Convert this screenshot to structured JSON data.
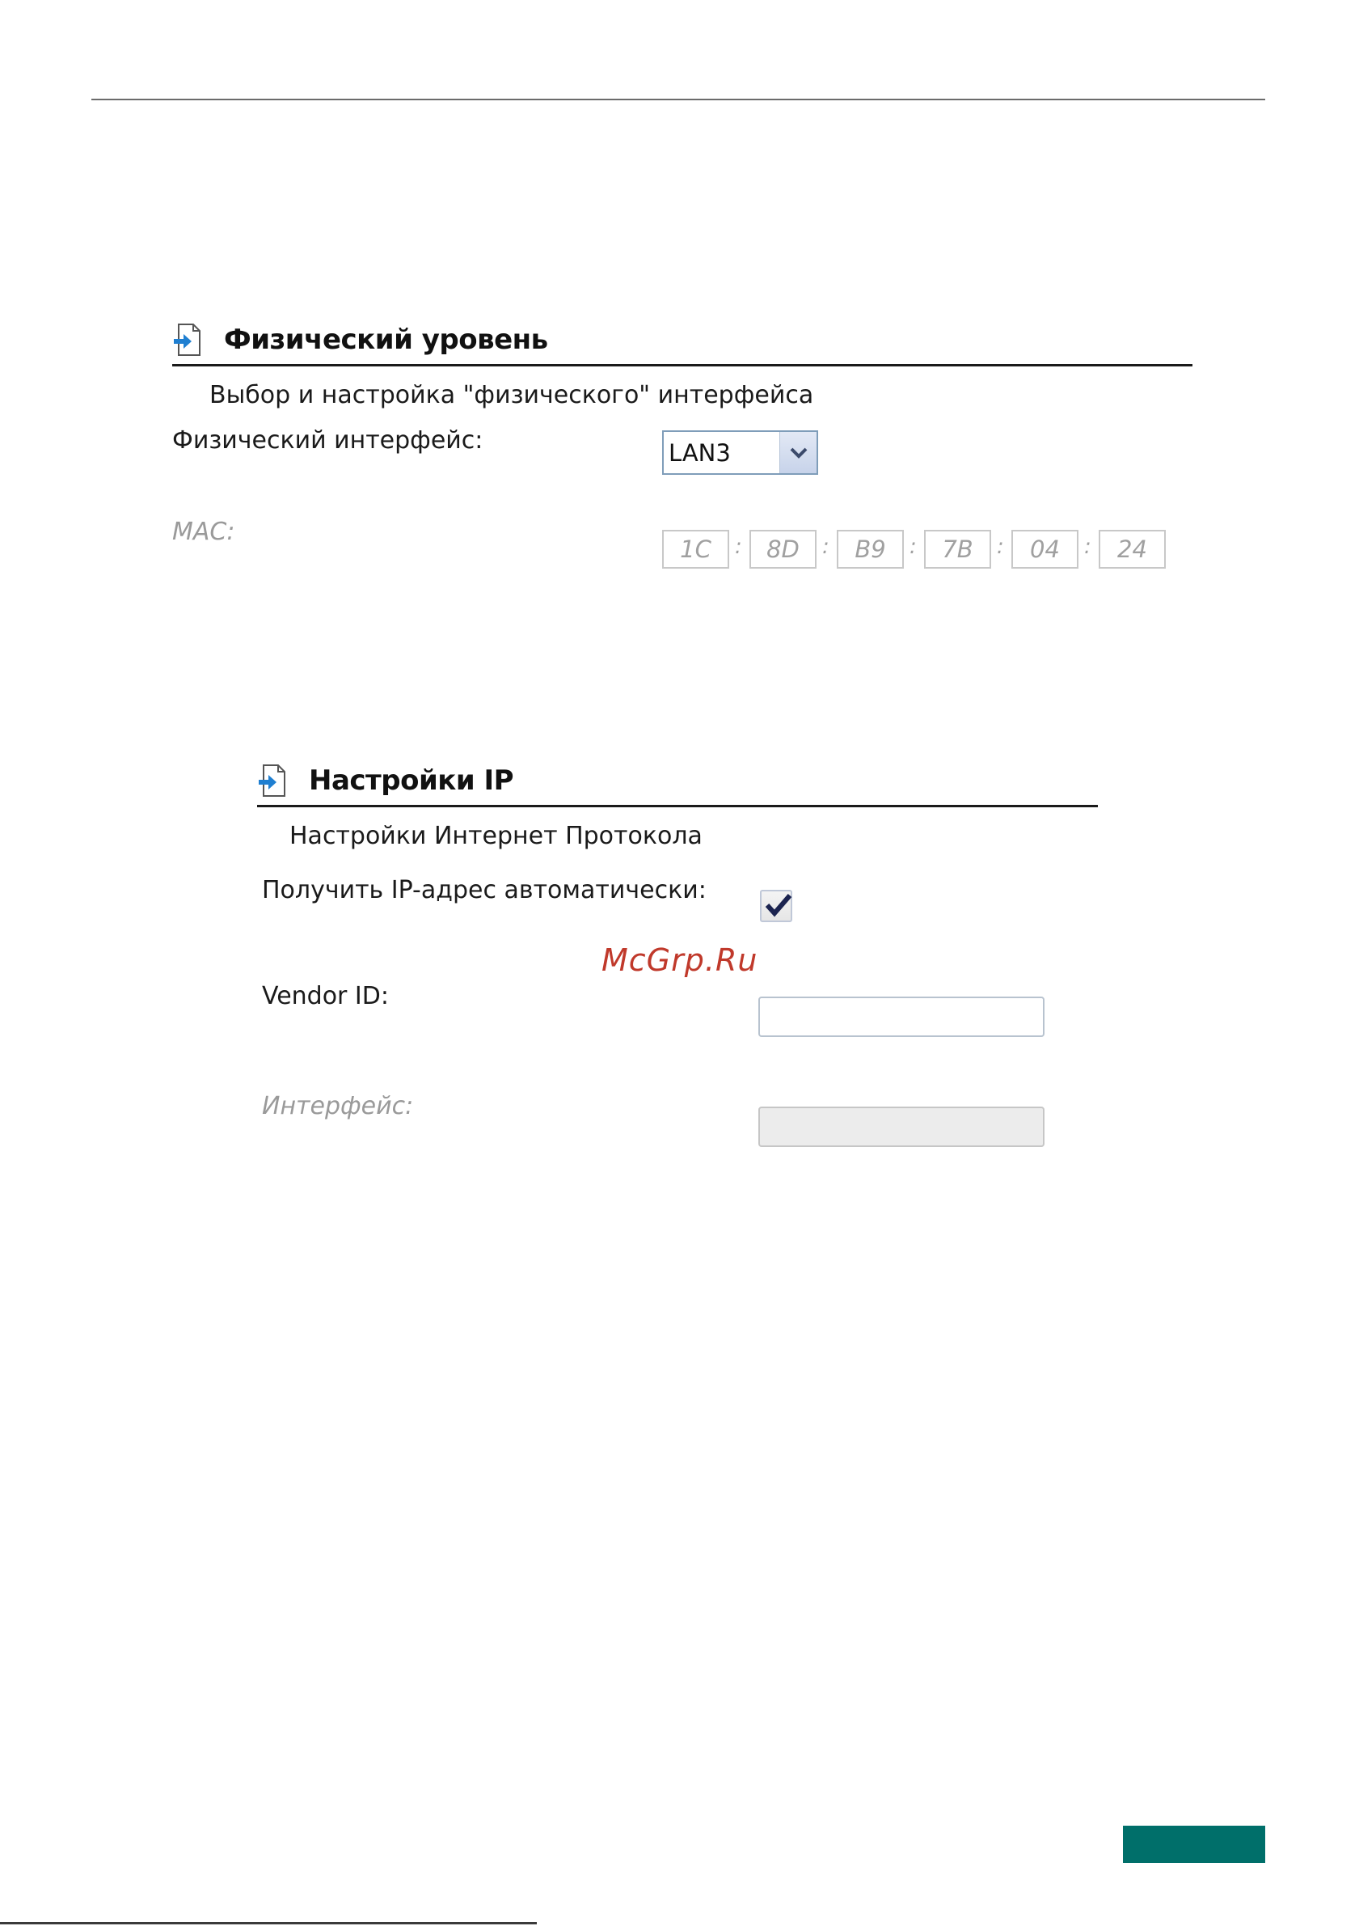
{
  "physical": {
    "title": "Физический уровень",
    "subtitle": "Выбор и настройка \"физического\" интерфейса",
    "interface_label": "Физический интерфейс:",
    "interface_value": "LAN3",
    "mac_label": "MAC:",
    "mac_octets": [
      "1C",
      "8D",
      "B9",
      "7B",
      "04",
      "24"
    ],
    "mac_separator": ":"
  },
  "ip": {
    "title": "Настройки IP",
    "subtitle": "Настройки Интернет Протокола",
    "auto_ip_label": "Получить IP-адрес автоматически:",
    "auto_ip_checked": true,
    "vendor_label": "Vendor ID:",
    "vendor_value": "",
    "interface_label": "Интерфейс:",
    "interface_value": ""
  },
  "watermark": "McGrp.Ru",
  "colors": {
    "accent_teal": "#006f6a",
    "watermark": "#c0392b",
    "icon_arrow": "#1f7fd1"
  },
  "icons": {
    "section_icon": "doc-arrow-icon",
    "select_icon": "chevron-down-icon",
    "check_icon": "checkmark-icon"
  }
}
